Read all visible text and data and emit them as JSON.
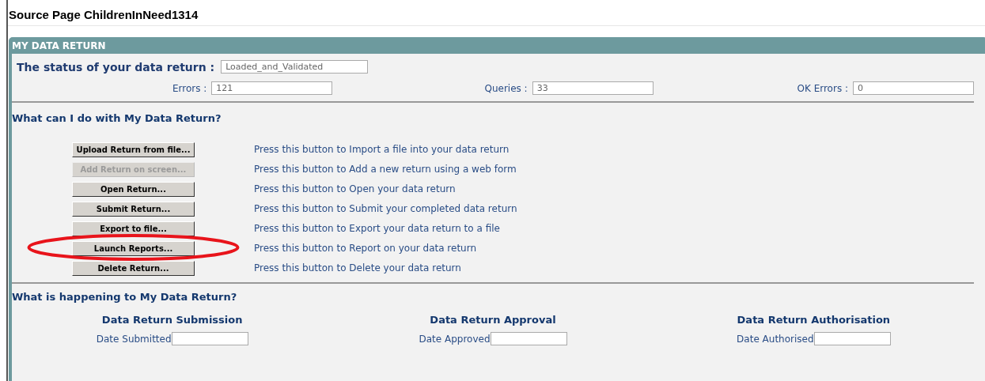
{
  "page_title": "Source Page ChildrenInNeed1314",
  "panel": {
    "title": "MY DATA RETURN",
    "status": {
      "label": "The status of your data return :",
      "value": "Loaded_and_Validated"
    },
    "counts": [
      {
        "label": "Errors :",
        "value": "121"
      },
      {
        "label": "Queries :",
        "value": "33"
      },
      {
        "label": "OK Errors :",
        "value": "0"
      }
    ],
    "actions_heading": "What can I do with My Data Return?",
    "actions": [
      {
        "button": "Upload Return from file...",
        "description": "Press this button to Import a file into your data return",
        "disabled": false,
        "circled": false
      },
      {
        "button": "Add Return on screen...",
        "description": "Press this button to Add a new return using a web form",
        "disabled": true,
        "circled": false
      },
      {
        "button": "Open Return...",
        "description": "Press this button to Open your data return",
        "disabled": false,
        "circled": false
      },
      {
        "button": "Submit Return...",
        "description": "Press this button to Submit your completed data return",
        "disabled": false,
        "circled": false
      },
      {
        "button": "Export to file...",
        "description": "Press this button to Export your data return to a file",
        "disabled": false,
        "circled": false
      },
      {
        "button": "Launch Reports...",
        "description": "Press this button to Report on your data return",
        "disabled": false,
        "circled": true
      },
      {
        "button": "Delete Return...",
        "description": "Press this button to Delete your data return",
        "disabled": false,
        "circled": false
      }
    ],
    "progress_heading": "What is happening to My Data Return?",
    "stages": [
      {
        "title": "Data Return Submission",
        "date_label": "Date Submitted"
      },
      {
        "title": "Data Return Approval",
        "date_label": "Date Approved"
      },
      {
        "title": "Data Return Authorisation",
        "date_label": "Date Authorised"
      }
    ]
  }
}
